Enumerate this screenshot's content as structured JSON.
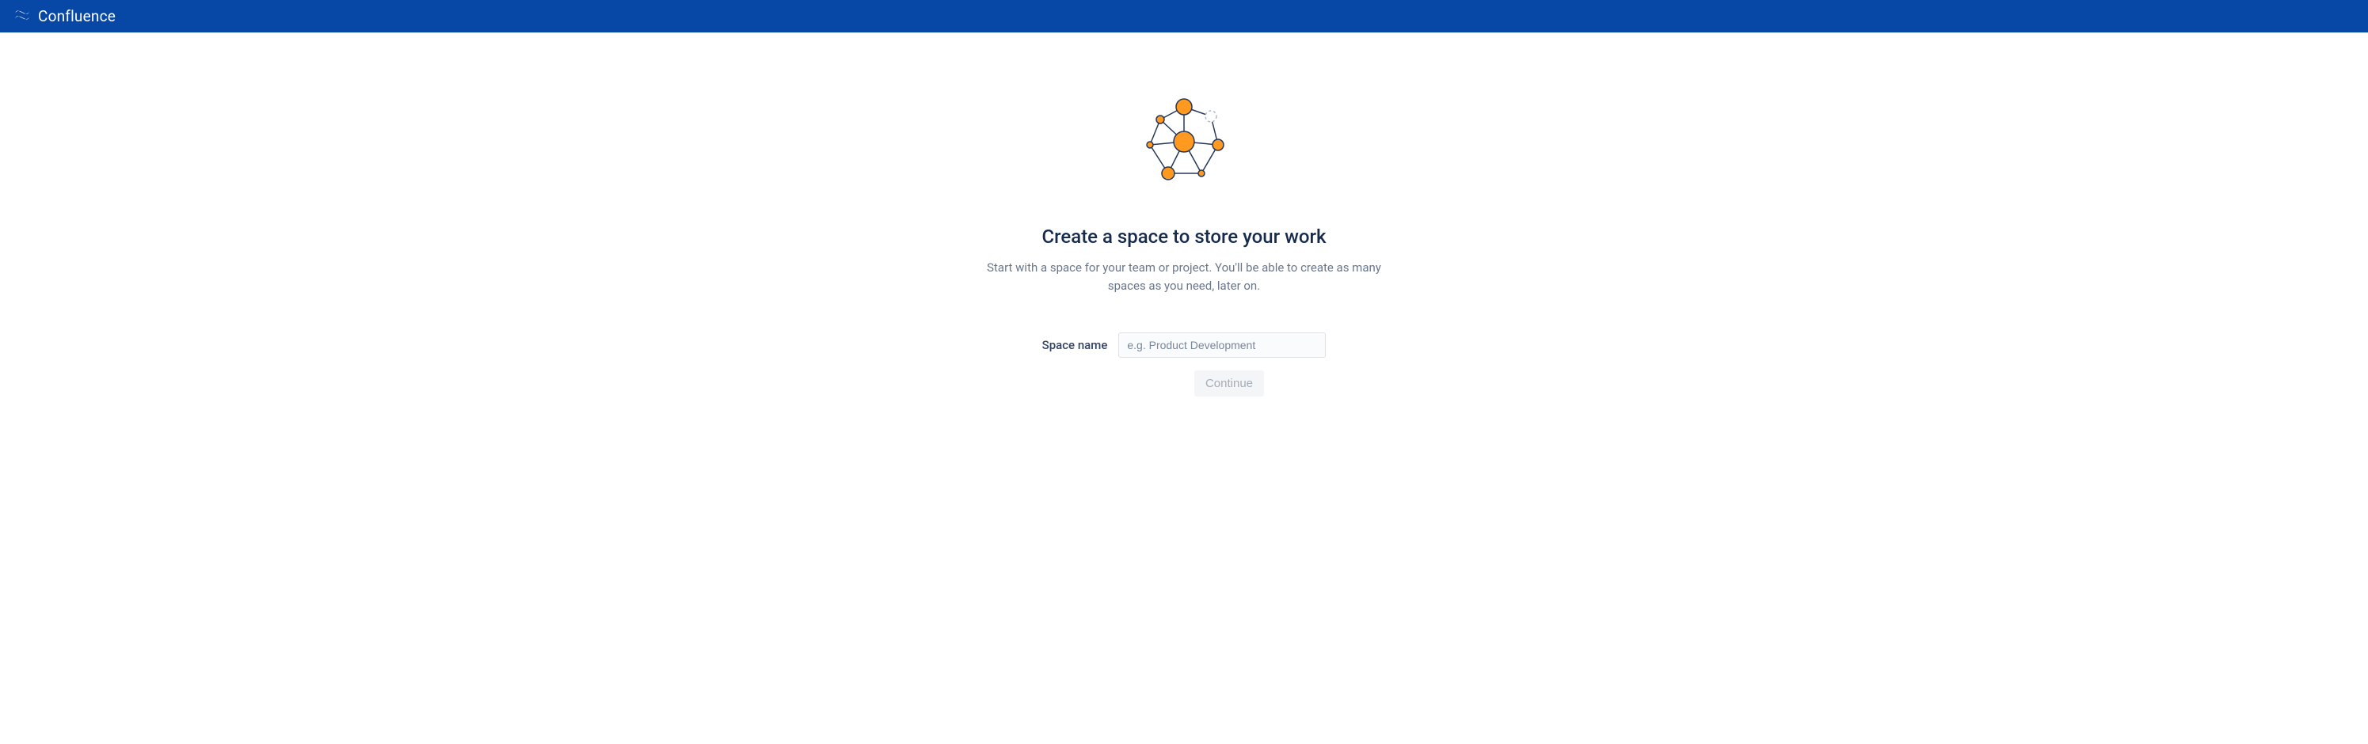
{
  "header": {
    "product_name": "Confluence"
  },
  "onboarding": {
    "title": "Create a space to store your work",
    "subtitle": "Start with a space for your team or project. You'll be able to create as many spaces as you need, later on.",
    "form": {
      "space_name_label": "Space name",
      "space_name_placeholder": "e.g. Product Development",
      "space_name_value": ""
    },
    "continue_button_label": "Continue"
  },
  "colors": {
    "brand_primary": "#0747a6",
    "accent_orange": "#ff991f",
    "text_primary": "#172b4d",
    "text_secondary": "#6b778c"
  }
}
